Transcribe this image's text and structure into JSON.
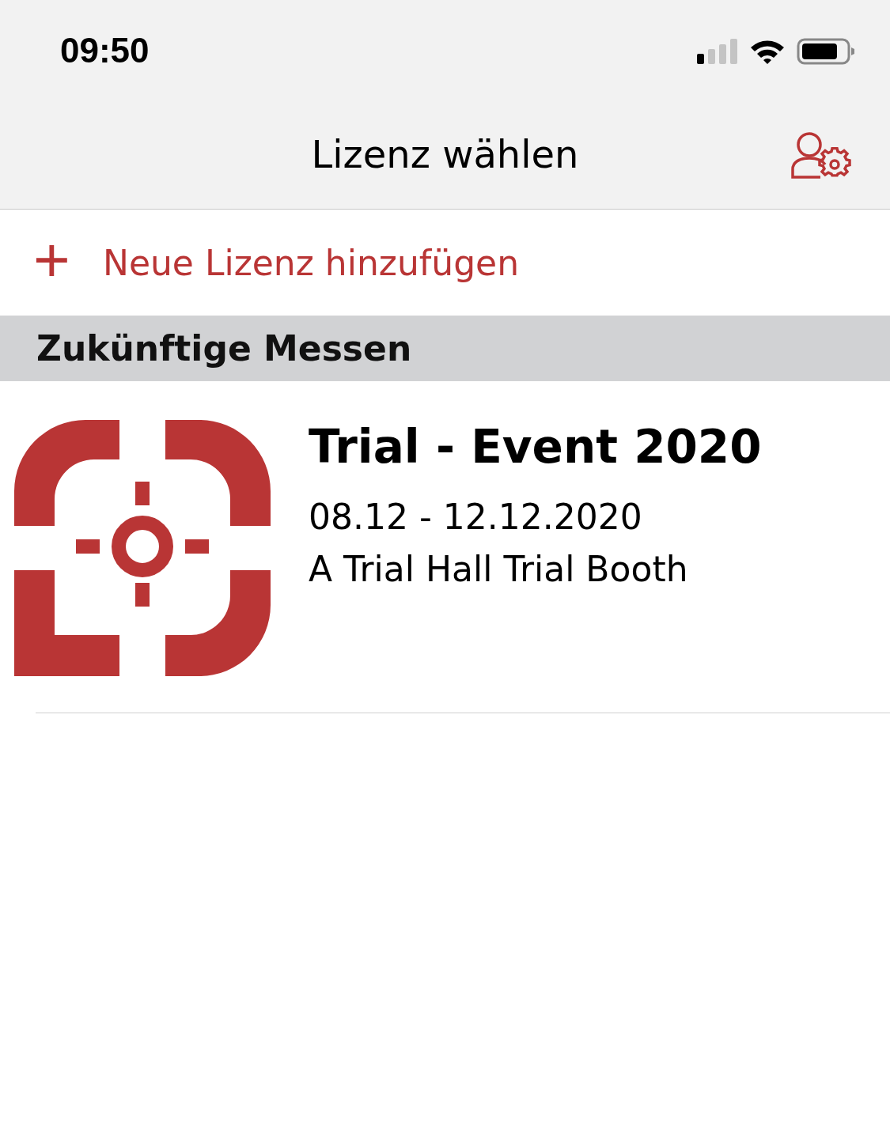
{
  "status_bar": {
    "time": "09:50"
  },
  "nav": {
    "title": "Lizenz wählen"
  },
  "add_license": {
    "icon": "+",
    "label": "Neue Lizenz hinzufügen"
  },
  "sections": [
    {
      "title": "Zukünftige Messen",
      "events": [
        {
          "title": "Trial - Event 2020",
          "dates": "08.12 - 12.12.2020",
          "location": "A Trial Hall Trial Booth"
        }
      ]
    }
  ]
}
